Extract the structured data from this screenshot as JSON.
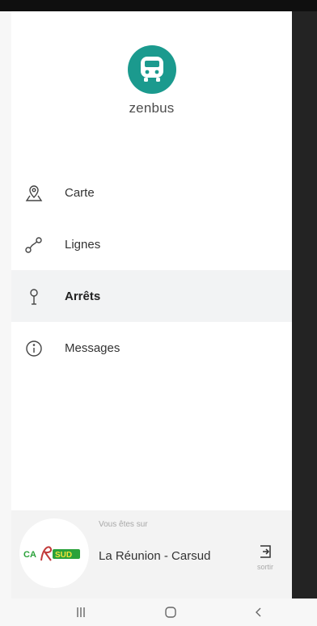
{
  "app": {
    "name": "zenbus",
    "brand_color": "#1b9a8e"
  },
  "menu": {
    "items": [
      {
        "label": "Carte",
        "icon": "map-pin-icon",
        "active": false
      },
      {
        "label": "Lignes",
        "icon": "route-icon",
        "active": false
      },
      {
        "label": "Arrêts",
        "icon": "bus-stop-icon",
        "active": true
      },
      {
        "label": "Messages",
        "icon": "info-icon",
        "active": false
      }
    ]
  },
  "network": {
    "caption": "Vous êtes sur",
    "name": "La Réunion - Carsud",
    "logo_text": "CARSUD",
    "exit_label": "sortir"
  },
  "navbar": {
    "buttons": [
      "recent-apps-icon",
      "home-icon",
      "back-icon"
    ]
  }
}
